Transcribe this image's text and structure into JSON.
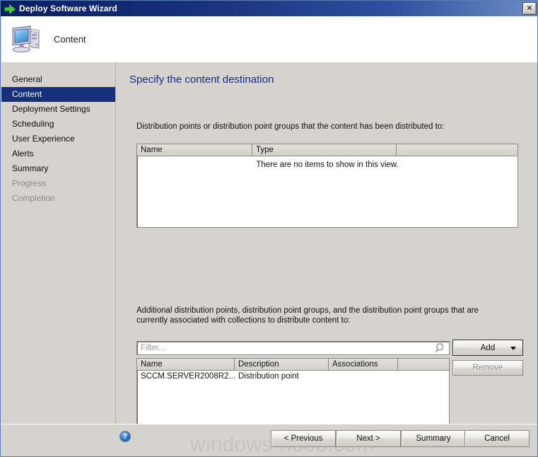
{
  "window": {
    "title": "Deploy Software Wizard",
    "close_label": "✕",
    "header_title": "Content",
    "icon": "computer-icon",
    "title_icon": "green-arrow-icon"
  },
  "sidebar": {
    "items": [
      {
        "label": "General",
        "state": "normal"
      },
      {
        "label": "Content",
        "state": "selected"
      },
      {
        "label": "Deployment Settings",
        "state": "normal"
      },
      {
        "label": "Scheduling",
        "state": "normal"
      },
      {
        "label": "User Experience",
        "state": "normal"
      },
      {
        "label": "Alerts",
        "state": "normal"
      },
      {
        "label": "Summary",
        "state": "normal"
      },
      {
        "label": "Progress",
        "state": "disabled"
      },
      {
        "label": "Completion",
        "state": "disabled"
      }
    ]
  },
  "main": {
    "heading": "Specify the content destination",
    "distributed_label": "Distribution points or distribution point groups that the content has been distributed to:",
    "distributed_table": {
      "columns": [
        "Name",
        "Type",
        ""
      ],
      "empty_message": "There are no items to show in this view.",
      "rows": []
    },
    "additional_label": "Additional distribution points, distribution point groups, and the distribution point groups that are currently associated with collections to distribute content to:",
    "filter": {
      "value": "",
      "placeholder": "Filter...",
      "icon": "search-icon"
    },
    "add_button": "Add",
    "remove_button": "Remove",
    "additional_table": {
      "columns": [
        "Name",
        "Description",
        "Associations",
        ""
      ],
      "rows": [
        {
          "name": "SCCM.SERVER2008R2....",
          "description": "Distribution point",
          "associations": ""
        }
      ]
    }
  },
  "footer": {
    "help_icon": "help-icon",
    "help_glyph": "?",
    "previous": "< Previous",
    "next": "Next >",
    "summary": "Summary",
    "cancel": "Cancel"
  },
  "watermark": "windows-noob.com",
  "colors": {
    "titlebar_start": "#0b1e63",
    "titlebar_end": "#6d8dc4",
    "selected_nav": "#16307c",
    "heading": "#1b2a85",
    "dialog_face": "#d6d3ce",
    "arrow_green": "#3ec93e"
  }
}
